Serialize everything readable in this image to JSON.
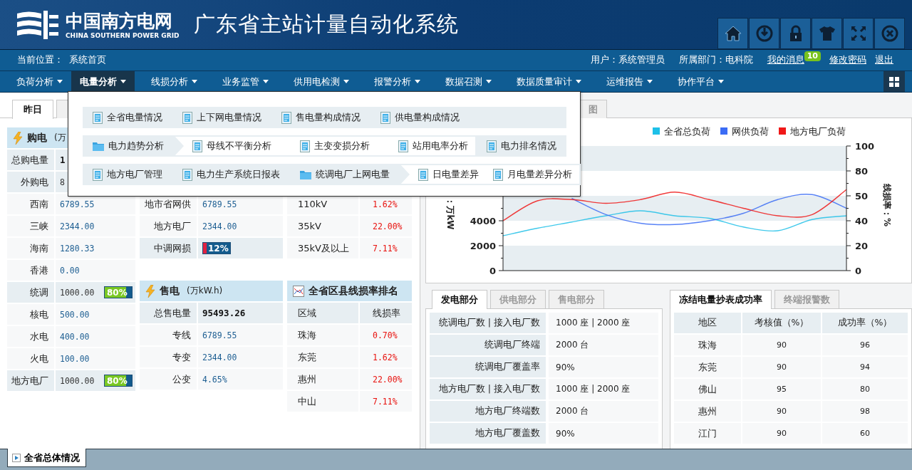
{
  "header": {
    "logo_name": "中国南方电网",
    "logo_subtitle": "CHINA SOUTHERN POWER GRID",
    "title": "广东省主站计量自动化系统"
  },
  "info_bar": {
    "location_label": "当前位置：",
    "location": "系统首页",
    "user": "用户：系统管理员",
    "department": "所属部门：电科院",
    "links": [
      {
        "label": "我的消息",
        "badge": "10"
      },
      {
        "label": "修改密码"
      },
      {
        "label": "退出"
      }
    ]
  },
  "nav": [
    {
      "label": "负荷分析",
      "selected": false
    },
    {
      "label": "电量分析",
      "selected": true
    },
    {
      "label": "线损分析",
      "selected": false
    },
    {
      "label": "业务监管",
      "selected": false
    },
    {
      "label": "供用电检测",
      "selected": false
    },
    {
      "label": "报警分析",
      "selected": false
    },
    {
      "label": "数据召测",
      "selected": false
    },
    {
      "label": "数据质量审计",
      "selected": false
    },
    {
      "label": "运维报告",
      "selected": false
    },
    {
      "label": "协作平台",
      "selected": false
    }
  ],
  "dropdown": {
    "rows": [
      [
        {
          "label": "全省电量情况",
          "kind": "doc"
        },
        {
          "label": "上下网电量情况",
          "kind": "doc"
        },
        {
          "label": "售电量构成情况",
          "kind": "doc"
        },
        {
          "label": "供电量构成情况",
          "kind": "doc"
        }
      ],
      [
        {
          "label": "电力趋势分析",
          "kind": "folder",
          "expanded": true,
          "children": [
            "母线不平衡分析",
            "主变变损分析",
            "站用电率分析"
          ]
        },
        {
          "label": "电力排名情况",
          "kind": "doc"
        }
      ],
      [
        {
          "label": "地方电厂管理",
          "kind": "doc"
        },
        {
          "label": "电力生产系统日报表",
          "kind": "doc"
        },
        {
          "label": "统调电厂上网电量",
          "kind": "folder",
          "expanded": true,
          "children": [
            "日电量差异",
            "月电量差异分析"
          ]
        }
      ]
    ]
  },
  "left_panel": {
    "tabs": [
      {
        "label": "昨日",
        "selected": true
      },
      {
        "selected": false
      }
    ],
    "columns": [
      {
        "sections": [
          {
            "title": "购电",
            "unit": "(万",
            "rows": [
              {
                "label": "总购电量",
                "value": "1",
                "kind": "group",
                "bold": true
              },
              {
                "label": "外购电",
                "value": "8",
                "kind": "group"
              },
              {
                "label": "西南",
                "value": "6789.55",
                "kind": "item"
              },
              {
                "label": "三峡",
                "value": "2344.00",
                "kind": "item"
              },
              {
                "label": "海南",
                "value": "1280.33",
                "kind": "item"
              },
              {
                "label": "香港",
                "value": "0.00",
                "kind": "item"
              },
              {
                "label": "统调",
                "value": "1000.00",
                "kind": "group",
                "bar": {
                  "text": "80%",
                  "level": 0.8
                }
              },
              {
                "label": "核电",
                "value": "500.00",
                "kind": "item"
              },
              {
                "label": "水电",
                "value": "400.00",
                "kind": "item"
              },
              {
                "label": "火电",
                "value": "100.00",
                "kind": "item"
              },
              {
                "label": "地方电厂",
                "value": "1000.00",
                "kind": "group",
                "bar": {
                  "text": "80%",
                  "level": 0.8
                }
              }
            ]
          }
        ]
      },
      {
        "sections": [
          {
            "rows": [
              {
                "label": "地市省网供",
                "value": "6789.55",
                "kind": "item"
              },
              {
                "label": "地方电厂",
                "value": "2344.00",
                "kind": "item"
              },
              {
                "label": "中调网损",
                "kind": "group",
                "bar": {
                  "text": "12%",
                  "level": 0.12
                }
              }
            ]
          },
          {
            "title": "售电",
            "unit": "(万kW.h)",
            "rows": [
              {
                "label": "总售电量",
                "value": "95493.26",
                "kind": "group",
                "bold": true
              },
              {
                "label": "专线",
                "value": "6789.55",
                "kind": "item"
              },
              {
                "label": "专变",
                "value": "2344.00",
                "kind": "item"
              },
              {
                "label": "公变",
                "value": "4.65%",
                "kind": "item"
              }
            ]
          }
        ]
      },
      {
        "sections": [
          {
            "rows": [
              {
                "label": "110kV",
                "value": "1.62%",
                "kind": "rate"
              },
              {
                "label": "35kV",
                "value": "22.00%",
                "kind": "rate"
              },
              {
                "label": "35kV及以上",
                "value": "7.11%",
                "kind": "rate"
              }
            ]
          },
          {
            "title": "全省区县线损率排名",
            "rows": [
              {
                "label": "区域",
                "value": "线损率",
                "kind": "head"
              },
              {
                "label": "珠海",
                "value": "0.70%",
                "kind": "rate"
              },
              {
                "label": "东莞",
                "value": "1.62%",
                "kind": "rate"
              },
              {
                "label": "惠州",
                "value": "22.00%",
                "kind": "rate"
              },
              {
                "label": "中山",
                "value": "7.11%",
                "kind": "rate"
              }
            ]
          }
        ]
      }
    ]
  },
  "chart_panel": {
    "tabs": [
      {
        "label": "图",
        "selected": false
      }
    ],
    "right_axis": {
      "label": "线损率：%",
      "ticks": [
        "100",
        "80",
        "50",
        "40",
        "20",
        "0"
      ]
    },
    "chart_data": {
      "type": "line",
      "ylabel": "：万kW",
      "ylim": [
        0,
        10000
      ],
      "yticks": [
        0,
        2000,
        4000
      ],
      "legend": "top",
      "series": [
        {
          "name": "全省总负荷",
          "color": "#1ec0e8",
          "values": [
            2800,
            3400,
            3900,
            4400,
            4800,
            4400,
            4200,
            3500,
            3200,
            4100,
            4400
          ]
        },
        {
          "name": "网供负荷",
          "color": "#3b6cf5",
          "values": [
            null,
            null,
            5800,
            4500,
            3800,
            3700,
            4000,
            4600,
            5700,
            6100,
            5000
          ]
        },
        {
          "name": "地方电厂负荷",
          "color": "#f01818",
          "values": [
            4000,
            5600,
            5700,
            5400,
            5700,
            6300,
            5700,
            5000,
            4400,
            4500,
            6500
          ]
        }
      ]
    }
  },
  "generation_panel": {
    "tabs": [
      {
        "label": "发电部分",
        "selected": true
      },
      {
        "label": "供电部分",
        "selected": false
      },
      {
        "label": "售电部分",
        "selected": false
      }
    ],
    "rows": [
      {
        "label": "统调电厂数 | 接入电厂数",
        "value": "1000 座 | 2000 座"
      },
      {
        "label": "统调电厂终端",
        "value": "2000 台"
      },
      {
        "label": "统调电厂覆盖率",
        "value": "90%"
      },
      {
        "label": "地方电厂数 | 接入电厂数",
        "value": "1000 座 | 2000 座"
      },
      {
        "label": "地方电厂终端数",
        "value": "2000 台"
      },
      {
        "label": "地方电厂覆盖数",
        "value": "90%"
      }
    ]
  },
  "success_panel": {
    "tabs": [
      {
        "label": "冻结电量抄表成功率",
        "selected": true
      },
      {
        "label": "终端报警数",
        "selected": false
      }
    ],
    "columns": [
      "地区",
      "考核值（%）",
      "成功率（%）"
    ],
    "rows": [
      [
        "珠海",
        "90",
        "96"
      ],
      [
        "东莞",
        "90",
        "94"
      ],
      [
        "佛山",
        "95",
        "80"
      ],
      [
        "惠州",
        "90",
        "98"
      ],
      [
        "江门",
        "90",
        "60"
      ]
    ]
  },
  "footer": {
    "tab": "全省总体情况"
  }
}
